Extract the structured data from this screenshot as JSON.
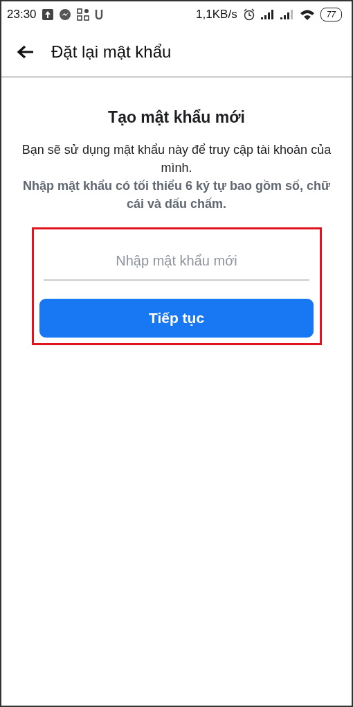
{
  "status_bar": {
    "time": "23:30",
    "speed": "1,1KB/s",
    "battery": "77"
  },
  "app_bar": {
    "title": "Đặt lại mật khẩu"
  },
  "heading": "Tạo mật khẩu mới",
  "description": "Bạn sẽ sử dụng mật khẩu này để truy cập tài khoản của mình.",
  "hint": "Nhập mật khẩu có tối thiểu 6 ký tự bao gồm số, chữ cái và dấu chấm.",
  "form": {
    "highlighted": true,
    "password": {
      "placeholder": "Nhập mật khẩu mới"
    },
    "button": "Tiếp tục"
  }
}
